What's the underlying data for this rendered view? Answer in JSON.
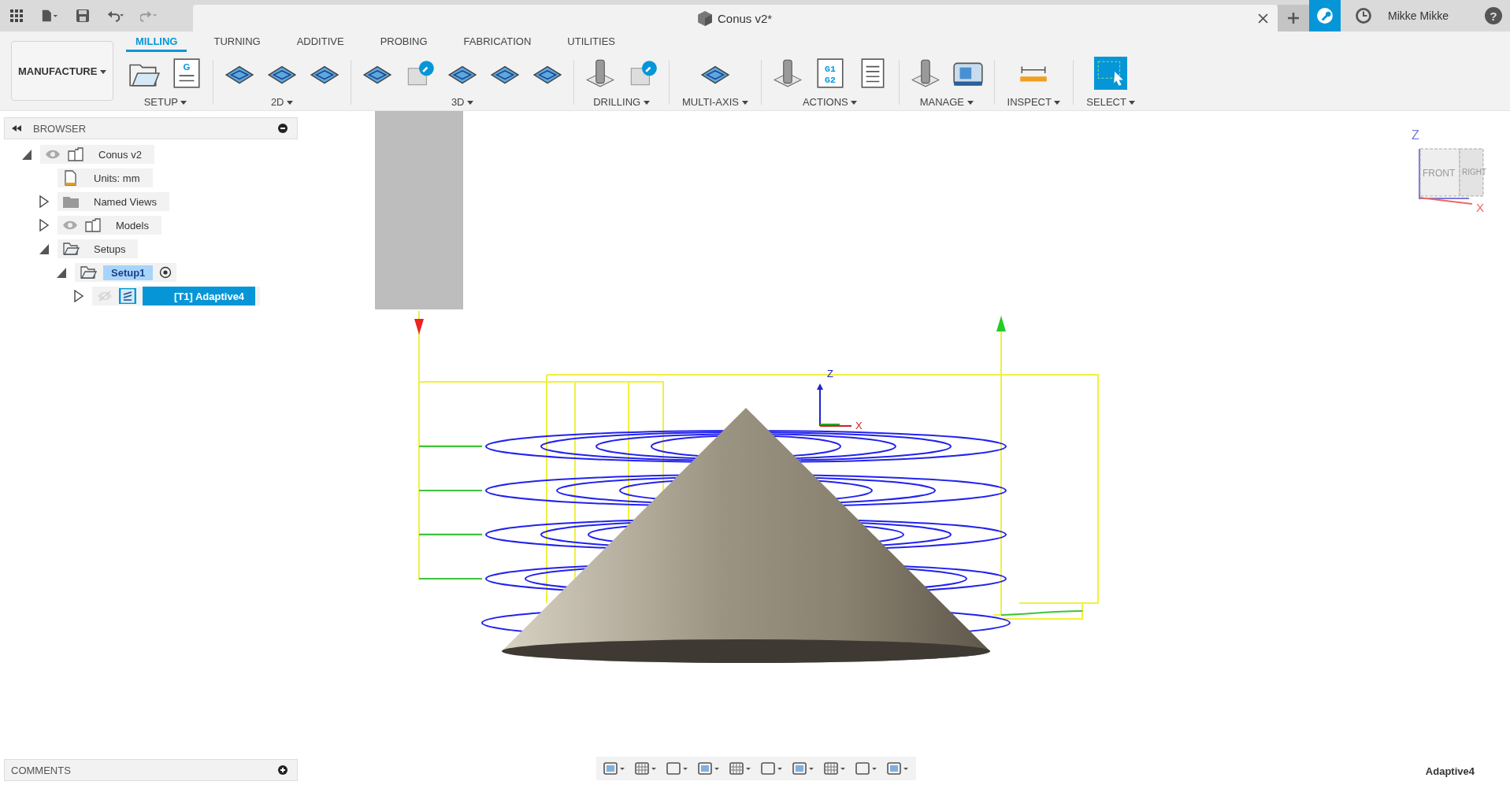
{
  "window": {
    "title": "Conus v2*",
    "user": "Mikke Mikke",
    "help": "?"
  },
  "workspace": {
    "label": "MANUFACTURE"
  },
  "tabs": [
    {
      "label": "MILLING",
      "selected": true
    },
    {
      "label": "TURNING",
      "selected": false
    },
    {
      "label": "ADDITIVE",
      "selected": false
    },
    {
      "label": "PROBING",
      "selected": false
    },
    {
      "label": "FABRICATION",
      "selected": false
    },
    {
      "label": "UTILITIES",
      "selected": false
    }
  ],
  "groups": [
    {
      "label": "SETUP",
      "icon_texts": [
        "G"
      ]
    },
    {
      "label": "2D"
    },
    {
      "label": "3D"
    },
    {
      "label": "DRILLING"
    },
    {
      "label": "MULTI-AXIS"
    },
    {
      "label": "ACTIONS",
      "icon_texts": [
        "G1",
        "G2"
      ]
    },
    {
      "label": "MANAGE"
    },
    {
      "label": "INSPECT"
    },
    {
      "label": "SELECT"
    }
  ],
  "browser": {
    "title": "BROWSER",
    "tree": [
      {
        "label": "Conus v2",
        "kind": "component",
        "expanded": true,
        "visible": true,
        "selected": false,
        "active": false,
        "children": [
          {
            "label": "Units: mm",
            "kind": "units",
            "selected": false,
            "active": false
          },
          {
            "label": "Named Views",
            "kind": "folder",
            "expanded": false,
            "selected": false,
            "active": false
          },
          {
            "label": "Models",
            "kind": "component",
            "expanded": false,
            "visible": true,
            "selected": false,
            "active": false
          },
          {
            "label": "Setups",
            "kind": "setup",
            "expanded": true,
            "selected": false,
            "active": false,
            "children": [
              {
                "label": "Setup1",
                "kind": "setup",
                "expanded": true,
                "selected": false,
                "active": true,
                "children": [
                  {
                    "label": "[T1] Adaptive4",
                    "kind": "operation",
                    "expanded": false,
                    "visible": false,
                    "selected": true,
                    "active": false
                  }
                ]
              }
            ]
          }
        ]
      }
    ]
  },
  "view_cube": {
    "axes": [
      "Z",
      "X"
    ],
    "faces": [
      "FRONT",
      "RIGHT"
    ]
  },
  "triad": {
    "axes": [
      "Z",
      "X"
    ]
  },
  "comments": {
    "title": "COMMENTS"
  },
  "status": {
    "text": "Adaptive4"
  }
}
